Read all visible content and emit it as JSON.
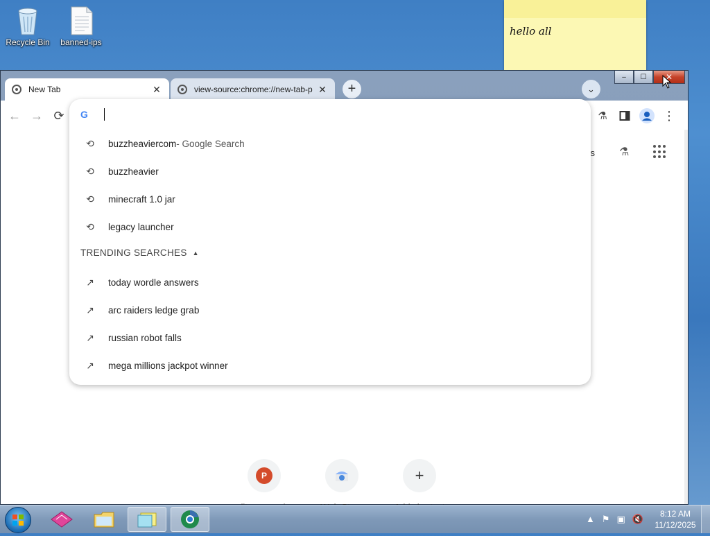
{
  "desktop": {
    "icons": [
      {
        "label": "Recycle Bin"
      },
      {
        "label": "banned-ips"
      }
    ],
    "sticky_note": {
      "text": "hello all"
    }
  },
  "browser": {
    "tabs": [
      {
        "label": "New Tab",
        "active": true
      },
      {
        "label": "view-source:chrome://new-tab-p",
        "active": false
      }
    ],
    "new_tab_symbol": "+",
    "window_controls": {
      "minimize": "–",
      "maximize": "☐",
      "close": "✕"
    },
    "toolbar": {
      "back": "←",
      "forward": "→",
      "reload": "⟳"
    },
    "ntp": {
      "apps_label_partial": "ges",
      "shortcuts": [
        {
          "label": "ditmemay.zip",
          "initial": "P",
          "color": "#d44b2b"
        },
        {
          "label": "Web Store",
          "initial": "",
          "color": "#4a89dc"
        },
        {
          "label": "Add shortcut",
          "initial": "+",
          "color": "#333333"
        }
      ]
    },
    "omnibox_dropdown": {
      "history": [
        {
          "text": "buzzheaviercom",
          "sub": " - Google Search"
        },
        {
          "text": "buzzheavier",
          "sub": ""
        },
        {
          "text": "minecraft 1.0 jar",
          "sub": ""
        },
        {
          "text": "legacy launcher",
          "sub": ""
        }
      ],
      "trending_header": "TRENDING SEARCHES",
      "trending": [
        {
          "text": "today wordle answers"
        },
        {
          "text": "arc raiders ledge grab"
        },
        {
          "text": "russian robot falls"
        },
        {
          "text": "mega millions jackpot winner"
        }
      ]
    }
  },
  "taskbar": {
    "clock_time": "8:12 AM",
    "clock_date": "11/12/2025"
  }
}
